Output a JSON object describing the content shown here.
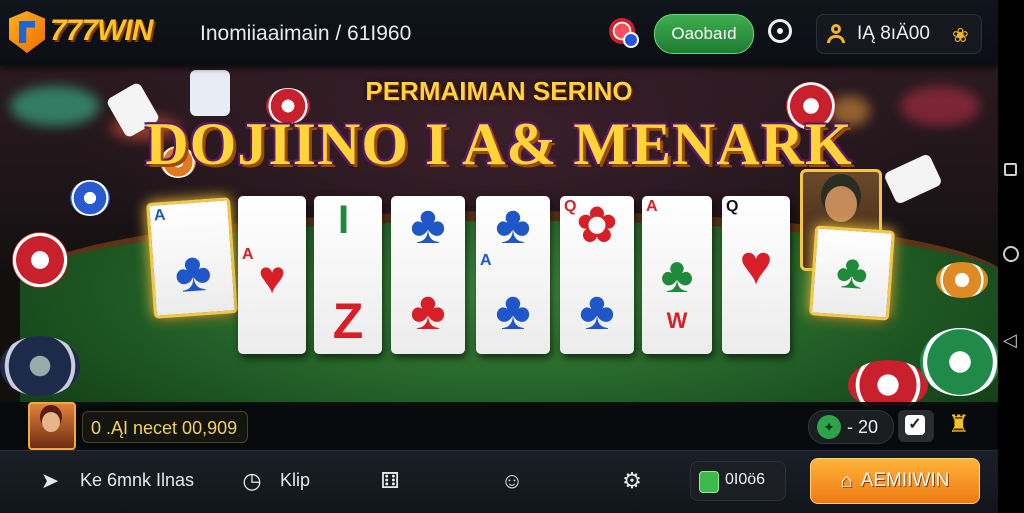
{
  "header": {
    "logo_text": "777WIN",
    "nav_title": "Inomiiaaimain / 61I960",
    "vbutton_label": "Oaobaıd",
    "balance": "IĄ 8ıӒ00"
  },
  "banner": {
    "subtitle": "PERMAIMAN SERINO",
    "headline": "DOJIINO I A& MENARK"
  },
  "cards": [
    {
      "rank": "A",
      "suit": "♣",
      "color": "blue"
    },
    {
      "rank": "A",
      "suit": "♥",
      "color": "red"
    },
    {
      "rank": "I",
      "suit": "Z",
      "color": "red"
    },
    {
      "rank": "",
      "suit": "♣",
      "color": "blue"
    },
    {
      "rank": "A",
      "suit": "♣",
      "color": "blue"
    },
    {
      "rank": "Q",
      "suit": "♣",
      "color": "blue"
    },
    {
      "rank": "A",
      "suit": "♣",
      "color": "green"
    },
    {
      "rank": "Q",
      "suit": "♥",
      "color": "red"
    }
  ],
  "status": {
    "bet_text": "0 .ĄI necet 00,909",
    "score": "- 20"
  },
  "bottom_nav": {
    "item1_label": "Ke 6mnk Ilnas",
    "item2_label": "Klip",
    "coin_text": "0I0ö6",
    "main_button_label": "AEMIIWIN"
  },
  "colors": {
    "accent_gold": "#ffd43a",
    "button_green": "#2f9a40",
    "button_orange": "#f58a1e",
    "table_green": "#2f7a33"
  }
}
